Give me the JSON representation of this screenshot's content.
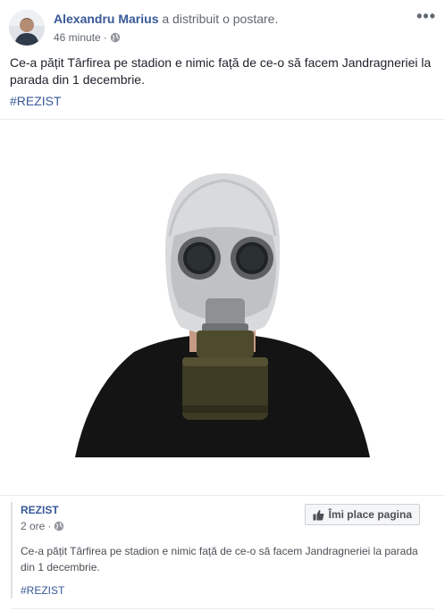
{
  "post": {
    "author_name": "Alexandru Marius",
    "author_action": "a distribuit o postare.",
    "timestamp": "46 minute",
    "privacy_icon": "globe-icon",
    "more_icon": "more-options-icon",
    "text": "Ce-a pățit Târfirea pe stadion e nimic față de ce-o să facem Jandragneriei la parada din 1 decembrie.",
    "hashtag": "#REZIST",
    "image_icon": "gas-mask-photo"
  },
  "shared": {
    "page_name": "REZIST",
    "timestamp": "2 ore",
    "privacy_icon": "globe-icon",
    "like_button_label": "Îmi place pagina",
    "like_icon": "thumbs-up-icon",
    "text": "Ce-a pățit Târfirea pe stadion e nimic față de ce-o să facem Jandragneriei la parada din 1 decembrie.",
    "hashtag": "#REZIST"
  },
  "colors": {
    "link": "#385898",
    "text": "#1d2129",
    "muted": "#616770"
  }
}
